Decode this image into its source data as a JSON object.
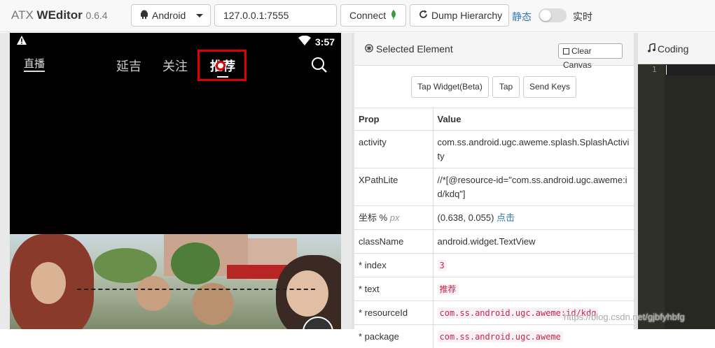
{
  "app": {
    "name_prefix": "ATX",
    "name": "WEditor",
    "version": "0.6.4"
  },
  "toolbar": {
    "platform": "Android",
    "serial": "127.0.0.1:7555",
    "connect_label": "Connect",
    "dump_label": "Dump Hierarchy",
    "mode_static": "静态",
    "mode_live": "实时"
  },
  "phone": {
    "time": "3:57",
    "live_label": "直播",
    "tabs": [
      "延吉",
      "关注",
      "推荐"
    ],
    "selected_tab_index": 2
  },
  "panel": {
    "title": "Selected Element",
    "clear_label": "Clear Canvas",
    "buttons": [
      "Tap Widget(Beta)",
      "Tap",
      "Send Keys"
    ],
    "header": {
      "prop": "Prop",
      "value": "Value"
    },
    "rows": [
      {
        "prop": "activity",
        "value": "com.ss.android.ugc.aweme.splash.SplashActivity"
      },
      {
        "prop": "XPathLite",
        "value": "//*[@resource-id=\"com.ss.android.ugc.aweme:id/kdq\"]"
      },
      {
        "prop": "坐标 %",
        "prop_hint": "px",
        "value": "(0.638, 0.055)",
        "value_link": "点击"
      },
      {
        "prop": "className",
        "value": "android.widget.TextView"
      },
      {
        "prop": "* index",
        "value": "3"
      },
      {
        "prop": "* text",
        "value": "推荐"
      },
      {
        "prop": "* resourceId",
        "value": "com.ss.android.ugc.aweme:id/kdq"
      },
      {
        "prop": "* package",
        "value": "com.ss.android.ugc.aweme"
      }
    ]
  },
  "coding": {
    "title": "Coding",
    "line_numbers": [
      "1"
    ]
  },
  "watermark": "https://blog.csdn.net/gjbfyhbfg",
  "colors": {
    "highlight": "#e00000",
    "link": "#337ab7",
    "code": "#c7254e",
    "editor_bg": "#272822"
  }
}
